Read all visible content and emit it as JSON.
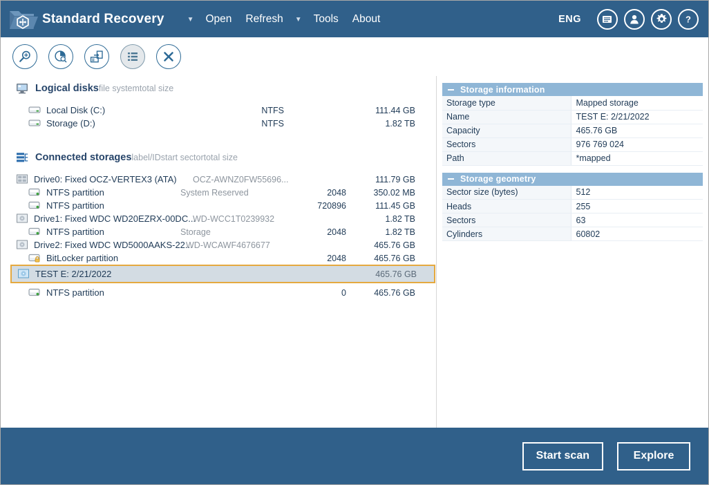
{
  "header": {
    "app_title": "Standard Recovery",
    "logo_icon": "folder-hexagon-logo-icon",
    "menu": [
      {
        "label": "Open",
        "caret": "▼",
        "has_caret": true
      },
      {
        "label": "Refresh",
        "caret": "",
        "has_caret": false
      },
      {
        "label": "Tools",
        "caret": "▼",
        "has_caret": true
      },
      {
        "label": "About",
        "caret": "",
        "has_caret": false
      }
    ],
    "language": "ENG",
    "buttons": [
      {
        "name": "messages-icon"
      },
      {
        "name": "user-account-icon"
      },
      {
        "name": "settings-gear-icon"
      },
      {
        "name": "help-question-icon"
      }
    ],
    "bg_color": "#30608a"
  },
  "toolbar": {
    "items": [
      {
        "name": "search-magnifier-icon",
        "active": false
      },
      {
        "name": "disk-scan-pie-icon",
        "active": false
      },
      {
        "name": "import-disk-icon",
        "active": false
      },
      {
        "name": "list-view-icon",
        "active": true
      },
      {
        "name": "close-x-icon",
        "active": false
      }
    ],
    "accent_color": "#2d6a96",
    "active_bg": "#e4e8eb"
  },
  "logical_disks": {
    "title": "Logical disks",
    "icon": "monitor-icon",
    "columns": {
      "file_system": "file system",
      "total_size": "total size"
    },
    "rows": [
      {
        "icon": "drive-icon",
        "label": "Local Disk (C:)",
        "file_system": "NTFS",
        "total_size": "111.44 GB"
      },
      {
        "icon": "drive-icon",
        "label": "Storage (D:)",
        "file_system": "NTFS",
        "total_size": "1.82 TB"
      }
    ]
  },
  "connected_storages": {
    "title": "Connected storages",
    "icon": "storages-stack-icon",
    "columns": {
      "label_id": "label/ID",
      "start_sector": "start sector",
      "total_size": "total size"
    },
    "rows": [
      {
        "icon": "physical-disk-icon",
        "label": "Drive0: Fixed OCZ-VERTEX3 (ATA)",
        "label_id": "OCZ-AWNZ0FW55696...",
        "start_sector": "",
        "total_size": "111.79 GB",
        "indent": 1,
        "selected": false
      },
      {
        "icon": "partition-icon",
        "label": "NTFS partition",
        "label_id": "System Reserved",
        "start_sector": "2048",
        "total_size": "350.02 MB",
        "indent": 2,
        "selected": false
      },
      {
        "icon": "partition-icon",
        "label": "NTFS partition",
        "label_id": "",
        "start_sector": "720896",
        "total_size": "111.45 GB",
        "indent": 2,
        "selected": false
      },
      {
        "icon": "physical-disk-icon",
        "label": "Drive1: Fixed WDC WD20EZRX-00DC...",
        "label_id": "WD-WCC1T0239932",
        "start_sector": "",
        "total_size": "1.82 TB",
        "indent": 1,
        "selected": false
      },
      {
        "icon": "partition-icon",
        "label": "NTFS partition",
        "label_id": "Storage",
        "start_sector": "2048",
        "total_size": "1.82 TB",
        "indent": 2,
        "selected": false
      },
      {
        "icon": "physical-disk-icon",
        "label": "Drive2: Fixed WDC WD5000AAKS-22...",
        "label_id": "WD-WCAWF4676677",
        "start_sector": "",
        "total_size": "465.76 GB",
        "indent": 1,
        "selected": false
      },
      {
        "icon": "bitlocker-lock-icon",
        "label": "BitLocker partition",
        "label_id": "",
        "start_sector": "2048",
        "total_size": "465.76 GB",
        "indent": 2,
        "selected": false
      },
      {
        "icon": "mapped-storage-icon",
        "label": "TEST E: 2/21/2022",
        "label_id": "",
        "start_sector": "",
        "total_size": "465.76 GB",
        "indent": 1,
        "selected": true
      },
      {
        "icon": "partition-icon",
        "label": "NTFS partition",
        "label_id": "",
        "start_sector": "0",
        "total_size": "465.76 GB",
        "indent": 2,
        "selected": false
      }
    ],
    "selection_border_color": "#e5a93f",
    "selection_bg_color": "#d3dce3"
  },
  "info_panel": {
    "sections": [
      {
        "title": "Storage information",
        "collapse_icon": "minus-collapse-icon",
        "rows": [
          {
            "key": "Storage type",
            "value": "Mapped storage"
          },
          {
            "key": "Name",
            "value": "TEST E: 2/21/2022"
          },
          {
            "key": "Capacity",
            "value": "465.76 GB"
          },
          {
            "key": "Sectors",
            "value": "976 769 024"
          },
          {
            "key": "Path",
            "value": "*mapped"
          }
        ]
      },
      {
        "title": "Storage geometry",
        "collapse_icon": "minus-collapse-icon",
        "rows": [
          {
            "key": "Sector size (bytes)",
            "value": "512"
          },
          {
            "key": "Heads",
            "value": "255"
          },
          {
            "key": "Sectors",
            "value": "63"
          },
          {
            "key": "Cylinders",
            "value": "60802"
          }
        ]
      }
    ],
    "header_bg_color": "#8fb6d6"
  },
  "footer": {
    "start_scan_label": "Start scan",
    "explore_label": "Explore",
    "bg_color": "#30608a"
  }
}
